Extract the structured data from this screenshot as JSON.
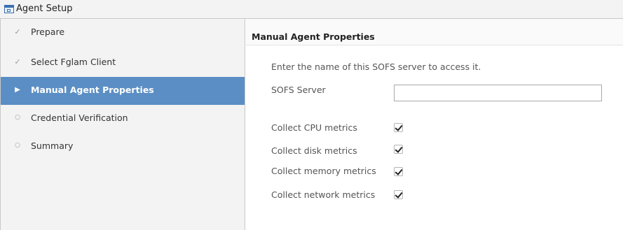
{
  "window": {
    "title": "Agent Setup"
  },
  "steps": [
    {
      "label": "Prepare",
      "state": "done",
      "marker": "✓"
    },
    {
      "label": "Select Fglam Client",
      "state": "done",
      "marker": "✓"
    },
    {
      "label": "Manual Agent Properties",
      "state": "active",
      "marker": "▶"
    },
    {
      "label": "Credential Verification",
      "state": "pending",
      "marker": "○"
    },
    {
      "label": "Summary",
      "state": "pending",
      "marker": "○"
    }
  ],
  "main": {
    "title": "Manual Agent Properties",
    "instruction": "Enter the name of this SOFS server to access it.",
    "server": {
      "label": "SOFS Server",
      "value": ""
    },
    "metrics": [
      {
        "label": "Collect CPU metrics",
        "checked": true
      },
      {
        "label": "Collect disk metrics",
        "checked": true
      },
      {
        "label": "Collect memory metrics",
        "checked": true
      },
      {
        "label": "Collect network metrics",
        "checked": true
      }
    ]
  },
  "colors": {
    "active_step": "#5b8ec4",
    "sidebar_bg": "#f3f3f3"
  }
}
